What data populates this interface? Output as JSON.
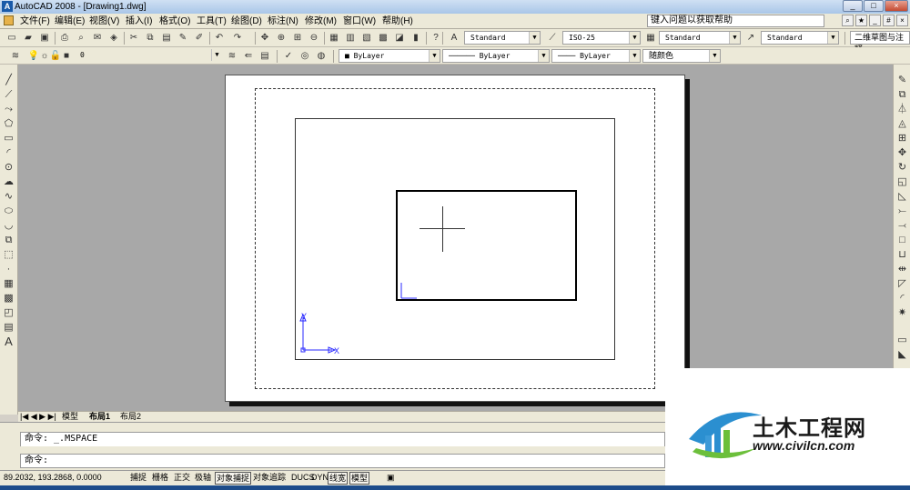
{
  "window": {
    "title": "AutoCAD 2008 - [Drawing1.dwg]",
    "icon": "autocad-icon",
    "buttons": [
      "_",
      "□",
      "×"
    ]
  },
  "menubar": {
    "items": [
      "文件(F)",
      "编辑(E)",
      "视图(V)",
      "插入(I)",
      "格式(O)",
      "工具(T)",
      "绘图(D)",
      "标注(N)",
      "修改(M)",
      "窗口(W)",
      "帮助(H)"
    ],
    "help_placeholder": "键入问题以获取帮助",
    "mdi_buttons": [
      "_",
      "#",
      "×"
    ]
  },
  "toolbar1": {
    "text_style": "Standard",
    "dim_style": "ISO-25",
    "table_style": "Standard",
    "multileader_style": "Standard",
    "workspace": "二维草图与注释"
  },
  "toolbar2": {
    "layer": "0",
    "color": "ByLayer",
    "linetype": "ByLayer",
    "lineweight": "ByLayer",
    "plotstyle": "随颜色"
  },
  "drawing": {
    "ucs_x": "X",
    "ucs_y": "Y"
  },
  "tabs": {
    "nav": "|◀ ◀ ▶ ▶|",
    "items": [
      "模型",
      "布局1",
      "布局2"
    ],
    "active": "布局1"
  },
  "command": {
    "line1": "命令:  _.MSPACE",
    "line2": "命令:"
  },
  "status": {
    "coords": "89.2032,  193.2868, 0.0000",
    "buttons": [
      "捕捉",
      "栅格",
      "正交",
      "极轴",
      "对象捕捉",
      "对象追踪",
      "DUCS",
      "DYN",
      "线宽",
      "模型"
    ],
    "on": [
      "对象捕捉",
      "对象追踪",
      "线宽",
      "模型"
    ]
  },
  "watermark": {
    "text": "土木工程网",
    "url": "www.civilcn.com"
  }
}
